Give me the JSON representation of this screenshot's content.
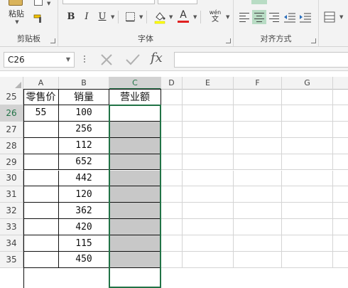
{
  "ribbon": {
    "clipboard": {
      "paste_label": "粘贴",
      "group_label": "剪贴板",
      "icons": [
        "paste-icon",
        "copy-icon",
        "format-painter-icon"
      ]
    },
    "font": {
      "group_label": "字体",
      "bold_label": "B",
      "italic_label": "I",
      "underline_label": "U",
      "font_color_label": "A",
      "phonetic_label": "wén",
      "phonetic_sub": "文",
      "font_color": "#e02020",
      "fill_color": "#ffff00"
    },
    "alignment": {
      "group_label": "对齐方式",
      "active_accent": "#b8dcc4"
    }
  },
  "formula_bar": {
    "name_box": "C26",
    "fx_label": "fx",
    "formula": ""
  },
  "sheet": {
    "columns": [
      "A",
      "B",
      "C",
      "D",
      "E",
      "F",
      "G"
    ],
    "selected_column": "C",
    "selected_cell": "C26",
    "header_row": {
      "row": "25",
      "cells": [
        "零售价",
        "销量",
        "营业额"
      ]
    },
    "rows": [
      {
        "row": "26",
        "a": "55",
        "b": "100",
        "c": ""
      },
      {
        "row": "27",
        "a": "",
        "b": "256",
        "c": ""
      },
      {
        "row": "28",
        "a": "",
        "b": "112",
        "c": ""
      },
      {
        "row": "29",
        "a": "",
        "b": "652",
        "c": ""
      },
      {
        "row": "30",
        "a": "",
        "b": "442",
        "c": ""
      },
      {
        "row": "31",
        "a": "",
        "b": "120",
        "c": ""
      },
      {
        "row": "32",
        "a": "",
        "b": "362",
        "c": ""
      },
      {
        "row": "33",
        "a": "",
        "b": "420",
        "c": ""
      },
      {
        "row": "34",
        "a": "",
        "b": "115",
        "c": ""
      },
      {
        "row": "35",
        "a": "",
        "b": "450",
        "c": ""
      }
    ],
    "selection_color": "#217346",
    "grey_fill": "#c8c8c8"
  }
}
